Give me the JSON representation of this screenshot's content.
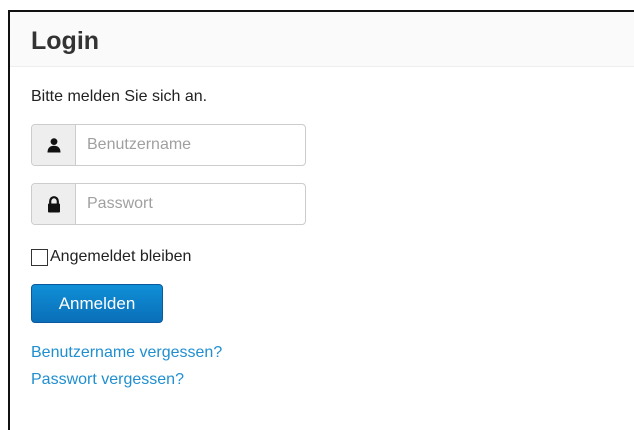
{
  "header": {
    "title": "Login"
  },
  "form": {
    "intro": "Bitte melden Sie sich an.",
    "username": {
      "placeholder": "Benutzername",
      "value": "",
      "icon": "user-icon"
    },
    "password": {
      "placeholder": "Passwort",
      "value": "",
      "icon": "lock-icon"
    },
    "remember": {
      "label": "Angemeldet bleiben",
      "checked": false
    },
    "submit_label": "Anmelden"
  },
  "links": {
    "forgot_username": "Benutzername vergessen?",
    "forgot_password": "Passwort vergessen?"
  },
  "colors": {
    "accent": "#0a6fb8",
    "link": "#1f8fd0"
  }
}
